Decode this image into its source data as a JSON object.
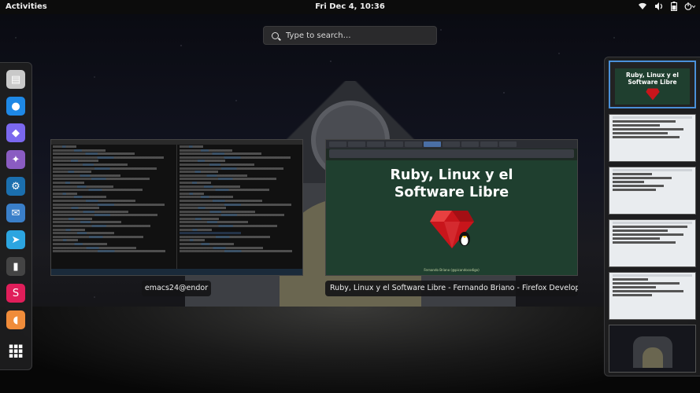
{
  "topbar": {
    "activities": "Activities",
    "clock": "Fri Dec  4, 10:36",
    "tray_icons": [
      "wifi-icon",
      "volume-icon",
      "battery-icon",
      "power-icon"
    ]
  },
  "search": {
    "placeholder": "Type to search…"
  },
  "dash": {
    "items": [
      {
        "name": "files-app",
        "glyph": "▤",
        "color": "#c9c9c9"
      },
      {
        "name": "firefox-app",
        "glyph": "●",
        "color": "#1e88e5"
      },
      {
        "name": "web-browser-app",
        "glyph": "◆",
        "color": "#7b68ee"
      },
      {
        "name": "emacs-app",
        "glyph": "✦",
        "color": "#8a5cc2"
      },
      {
        "name": "steam-app",
        "glyph": "⚙",
        "color": "#1b6fae"
      },
      {
        "name": "thunderbird-app",
        "glyph": "✉",
        "color": "#3a7fc9"
      },
      {
        "name": "telegram-app",
        "glyph": "➤",
        "color": "#2ca5e0"
      },
      {
        "name": "terminal-app",
        "glyph": "▮",
        "color": "#444444"
      },
      {
        "name": "slack-app",
        "glyph": "S",
        "color": "#e01e5a"
      },
      {
        "name": "clementine-app",
        "glyph": "◖",
        "color": "#f08c3a"
      },
      {
        "name": "show-applications",
        "glyph": "⋮⋮⋮",
        "color": "transparent"
      }
    ]
  },
  "windows": {
    "emacs": {
      "caption": "emacs24@endor"
    },
    "firefox": {
      "caption": "Ruby, Linux y el Software Libre - Fernando Briano - Firefox Developer ...",
      "slide_title_line1": "Ruby, Linux y el",
      "slide_title_line2": "Software Libre",
      "slide_footer": "Fernando Briano (@picandocodigo)"
    }
  },
  "workspaces": {
    "thumb1_title_line1": "Ruby, Linux y el",
    "thumb1_title_line2": "Software Libre"
  },
  "colors": {
    "accent": "#4a90d9",
    "slide_bg": "#1f3f2f"
  }
}
